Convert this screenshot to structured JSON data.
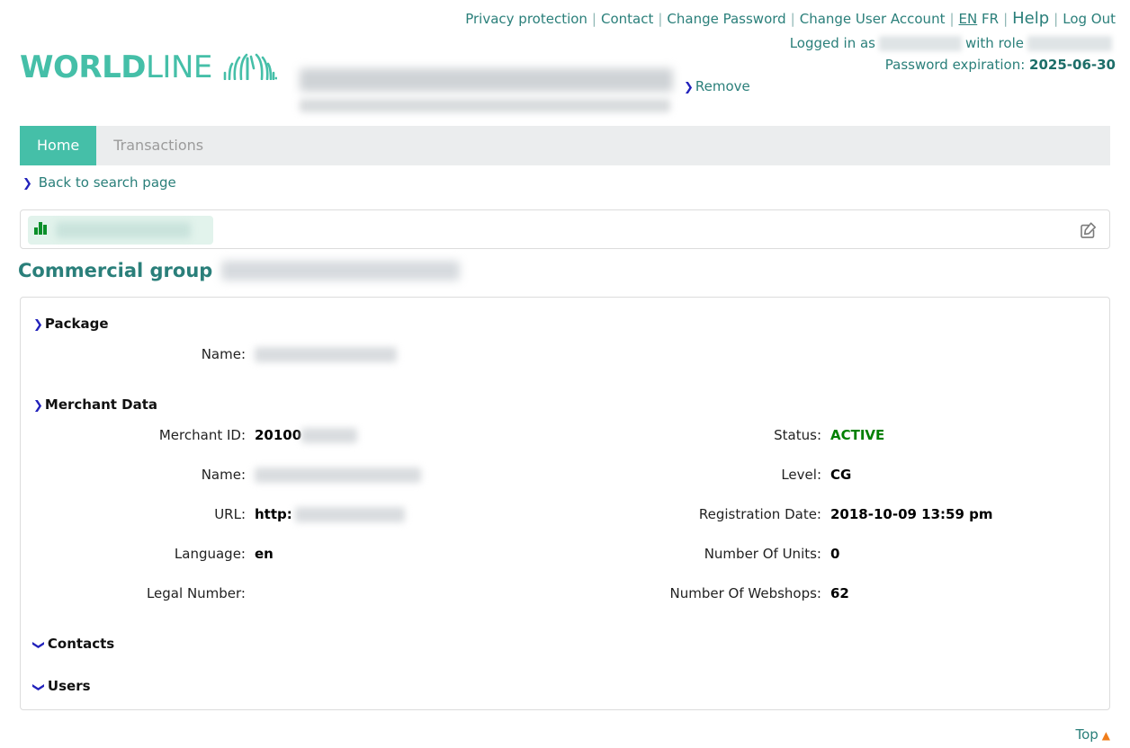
{
  "topbar": {
    "links": [
      {
        "label": "Privacy protection",
        "name": "privacy-protection-link"
      },
      {
        "label": "Contact",
        "name": "contact-link"
      },
      {
        "label": "Change Password",
        "name": "change-password-link"
      },
      {
        "label": "Change User Account",
        "name": "change-user-account-link"
      }
    ],
    "separator": "|",
    "lang_en": "EN",
    "lang_fr": "FR",
    "help": "Help",
    "logout": "Log Out",
    "logged_in_prefix": "Logged in as",
    "logged_in_middle": "with role",
    "password_expiration_label": "Password expiration:",
    "password_expiration_value": "2025-06-30"
  },
  "logo": {
    "word_bold": "WORLD",
    "word_light": "LINE",
    "mark": "wave-fan-icon"
  },
  "header": {
    "remove_label": "Remove",
    "merchant_title_redacted": true
  },
  "tabs": [
    {
      "label": "Home",
      "name": "tab-home",
      "active": true
    },
    {
      "label": "Transactions",
      "name": "tab-transactions",
      "active": false
    }
  ],
  "back_link": "Back to search page",
  "idbox": {
    "icon": "bar-chart-icon",
    "label_redacted": true,
    "edit_icon": "edit-square-icon"
  },
  "page_title": {
    "text": "Commercial group",
    "value_redacted": true
  },
  "sections": {
    "package": {
      "heading": "Package",
      "chevron": "chevron-right-icon",
      "fields": [
        {
          "label": "Name:",
          "value": "",
          "redacted": true,
          "redact_width": 158
        }
      ]
    },
    "merchant_data": {
      "heading": "Merchant Data",
      "chevron": "chevron-right-icon",
      "left_fields": [
        {
          "label": "Merchant ID:",
          "value": "20100",
          "redacted": true,
          "redact_width": 62
        },
        {
          "label": "Name:",
          "value": "",
          "redacted": true,
          "redact_width": 185
        },
        {
          "label": "URL:",
          "value": "http:",
          "redacted": true,
          "redact_width": 122
        },
        {
          "label": "Language:",
          "value": "en",
          "redacted": false,
          "redact_width": 0
        },
        {
          "label": "Legal Number:",
          "value": "",
          "redacted": false,
          "redact_width": 0
        }
      ],
      "right_fields": [
        {
          "label": "Status:",
          "value": "ACTIVE",
          "green": true
        },
        {
          "label": "Level:",
          "value": "CG",
          "green": false
        },
        {
          "label": "Registration Date:",
          "value": "2018-10-09 13:59 pm",
          "green": false
        },
        {
          "label": "Number Of Units:",
          "value": "0",
          "green": false
        },
        {
          "label": "Number Of Webshops:",
          "value": "62",
          "green": false
        }
      ]
    },
    "contacts": {
      "heading": "Contacts",
      "chevron": "chevron-down-icon"
    },
    "users": {
      "heading": "Users",
      "chevron": "chevron-down-icon"
    }
  },
  "footer": {
    "top_label": "Top",
    "top_icon": "triangle-up-icon"
  },
  "colors": {
    "teal": "#45bfa8",
    "teal_text": "#2a7f7a",
    "green_status": "#008000",
    "chevron_blue": "#2222bb",
    "tab_bg": "#ebedee",
    "orange": "#f07d1a"
  }
}
